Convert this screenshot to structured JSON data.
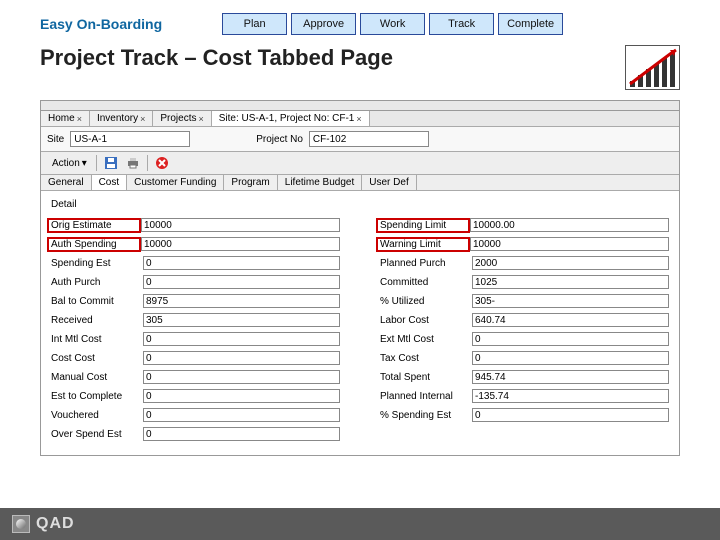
{
  "header": {
    "kicker": "Easy On-Boarding",
    "steps": [
      "Plan",
      "Approve",
      "Work",
      "Track",
      "Complete"
    ],
    "title_main": "Project Track",
    "title_sub": "– Cost Tabbed Page"
  },
  "tabs": [
    {
      "label": "Home",
      "closable": true
    },
    {
      "label": "Inventory",
      "closable": true
    },
    {
      "label": "Projects",
      "closable": true
    },
    {
      "label": "Site: US-A-1, Project No: CF-1",
      "closable": true,
      "active": true
    }
  ],
  "filter": {
    "site_label": "Site",
    "site_value": "US-A-1",
    "proj_label": "Project No",
    "proj_value": "CF-102"
  },
  "toolbar": {
    "action_label": "Action"
  },
  "subtabs": [
    "General",
    "Cost",
    "Customer Funding",
    "Program",
    "Lifetime Budget",
    "User Def"
  ],
  "subtab_active": 1,
  "detail": "Detail",
  "left_fields": [
    {
      "label": "Orig Estimate",
      "value": "10000",
      "hl": true
    },
    {
      "label": "Auth Spending",
      "value": "10000",
      "hl": true
    },
    {
      "label": "Spending Est",
      "value": "0"
    },
    {
      "label": "Auth Purch",
      "value": "0"
    },
    {
      "label": "Bal to Commit",
      "value": "8975"
    },
    {
      "label": "Received",
      "value": "305"
    },
    {
      "label": "Int Mtl Cost",
      "value": "0"
    },
    {
      "label": "Cost Cost",
      "value": "0"
    },
    {
      "label": "Manual Cost",
      "value": "0"
    },
    {
      "label": "Est to Complete",
      "value": "0"
    },
    {
      "label": "Vouchered",
      "value": "0"
    },
    {
      "label": "Over Spend Est",
      "value": "0"
    }
  ],
  "right_fields": [
    {
      "label": "Spending Limit",
      "value": "10000.00",
      "hl": true
    },
    {
      "label": "Warning Limit",
      "value": "10000",
      "hl": true
    },
    {
      "label": "Planned Purch",
      "value": "2000"
    },
    {
      "label": "Committed",
      "value": "1025"
    },
    {
      "label": "% Utilized",
      "value": "305-"
    },
    {
      "label": "Labor Cost",
      "value": "640.74"
    },
    {
      "label": "Ext Mtl Cost",
      "value": "0"
    },
    {
      "label": "Tax Cost",
      "value": "0"
    },
    {
      "label": "Total Spent",
      "value": "945.74"
    },
    {
      "label": "Planned Internal",
      "value": "-135.74"
    },
    {
      "label": "% Spending Est",
      "value": "0"
    }
  ],
  "footer": {
    "brand": "QAD"
  }
}
